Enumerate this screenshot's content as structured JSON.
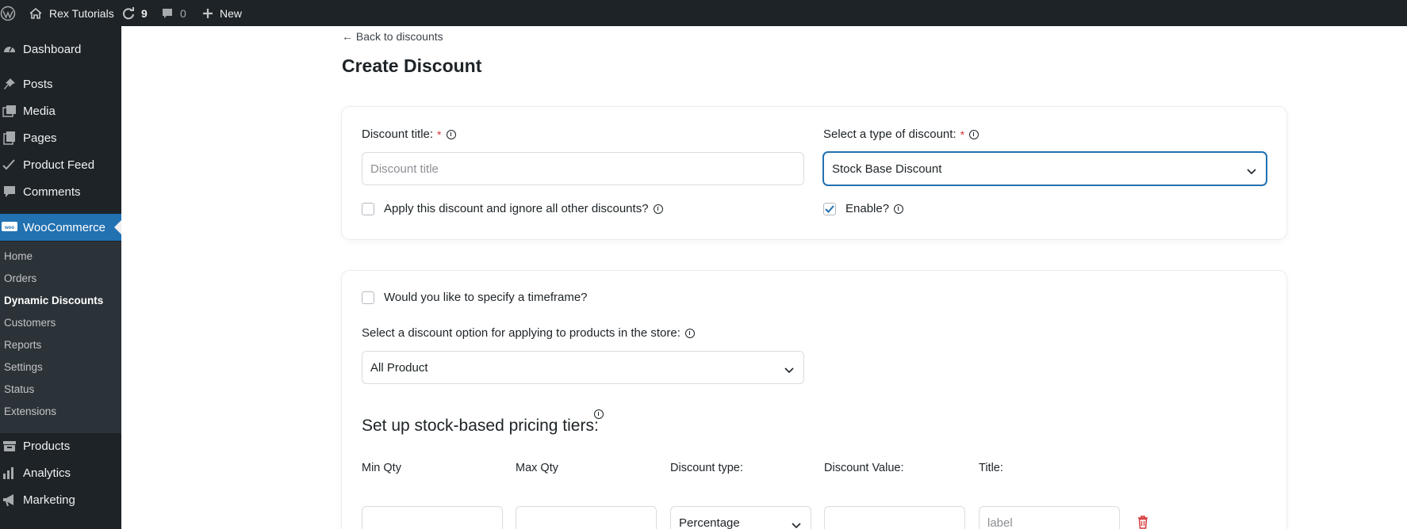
{
  "admin_bar": {
    "site_name": "Rex Tutorials",
    "updates_count": "9",
    "comments_count": "0",
    "new_label": "New"
  },
  "sidebar": {
    "top_items": [
      {
        "label": "Dashboard",
        "icon": "dashboard-icon"
      },
      {
        "label": "Posts",
        "icon": "pin-icon"
      },
      {
        "label": "Media",
        "icon": "media-icon"
      },
      {
        "label": "Pages",
        "icon": "pages-icon"
      },
      {
        "label": "Product Feed",
        "icon": "checkmark-icon"
      },
      {
        "label": "Comments",
        "icon": "comment-icon"
      }
    ],
    "woocommerce": {
      "label": "WooCommerce",
      "icon": "woo-icon"
    },
    "submenu": [
      "Home",
      "Orders",
      "Dynamic Discounts",
      "Customers",
      "Reports",
      "Settings",
      "Status",
      "Extensions"
    ],
    "bottom_items": [
      {
        "label": "Products",
        "icon": "archive-icon"
      },
      {
        "label": "Analytics",
        "icon": "bar-chart-icon"
      },
      {
        "label": "Marketing",
        "icon": "megaphone-icon"
      }
    ]
  },
  "page": {
    "back_link": "← Back to discounts",
    "title": "Create Discount"
  },
  "card1": {
    "title_label": "Discount title:",
    "title_placeholder": "Discount title",
    "type_label": "Select a type of discount:",
    "type_value": "Stock Base Discount",
    "exclusive_label": "Apply this discount and ignore all other discounts?",
    "exclusive_checked": false,
    "enable_label": "Enable?",
    "enable_checked": true,
    "required_mark": "*"
  },
  "card2": {
    "timeframe_label": "Would you like to specify a timeframe?",
    "option_label": "Select a discount option for applying to products in the store:",
    "option_value": "All Product",
    "tiers_heading": "Set up stock-based pricing tiers:",
    "columns": {
      "min_qty": "Min Qty",
      "max_qty": "Max Qty",
      "discount_type": "Discount type:",
      "discount_value": "Discount Value:",
      "title": "Title:"
    },
    "row": {
      "discount_type_value": "Percentage",
      "title_placeholder": "label"
    }
  },
  "colors": {
    "admin_dark": "#1d2327",
    "submenu_bg": "#2c3338",
    "accent": "#2271b1",
    "danger": "#d63638"
  }
}
